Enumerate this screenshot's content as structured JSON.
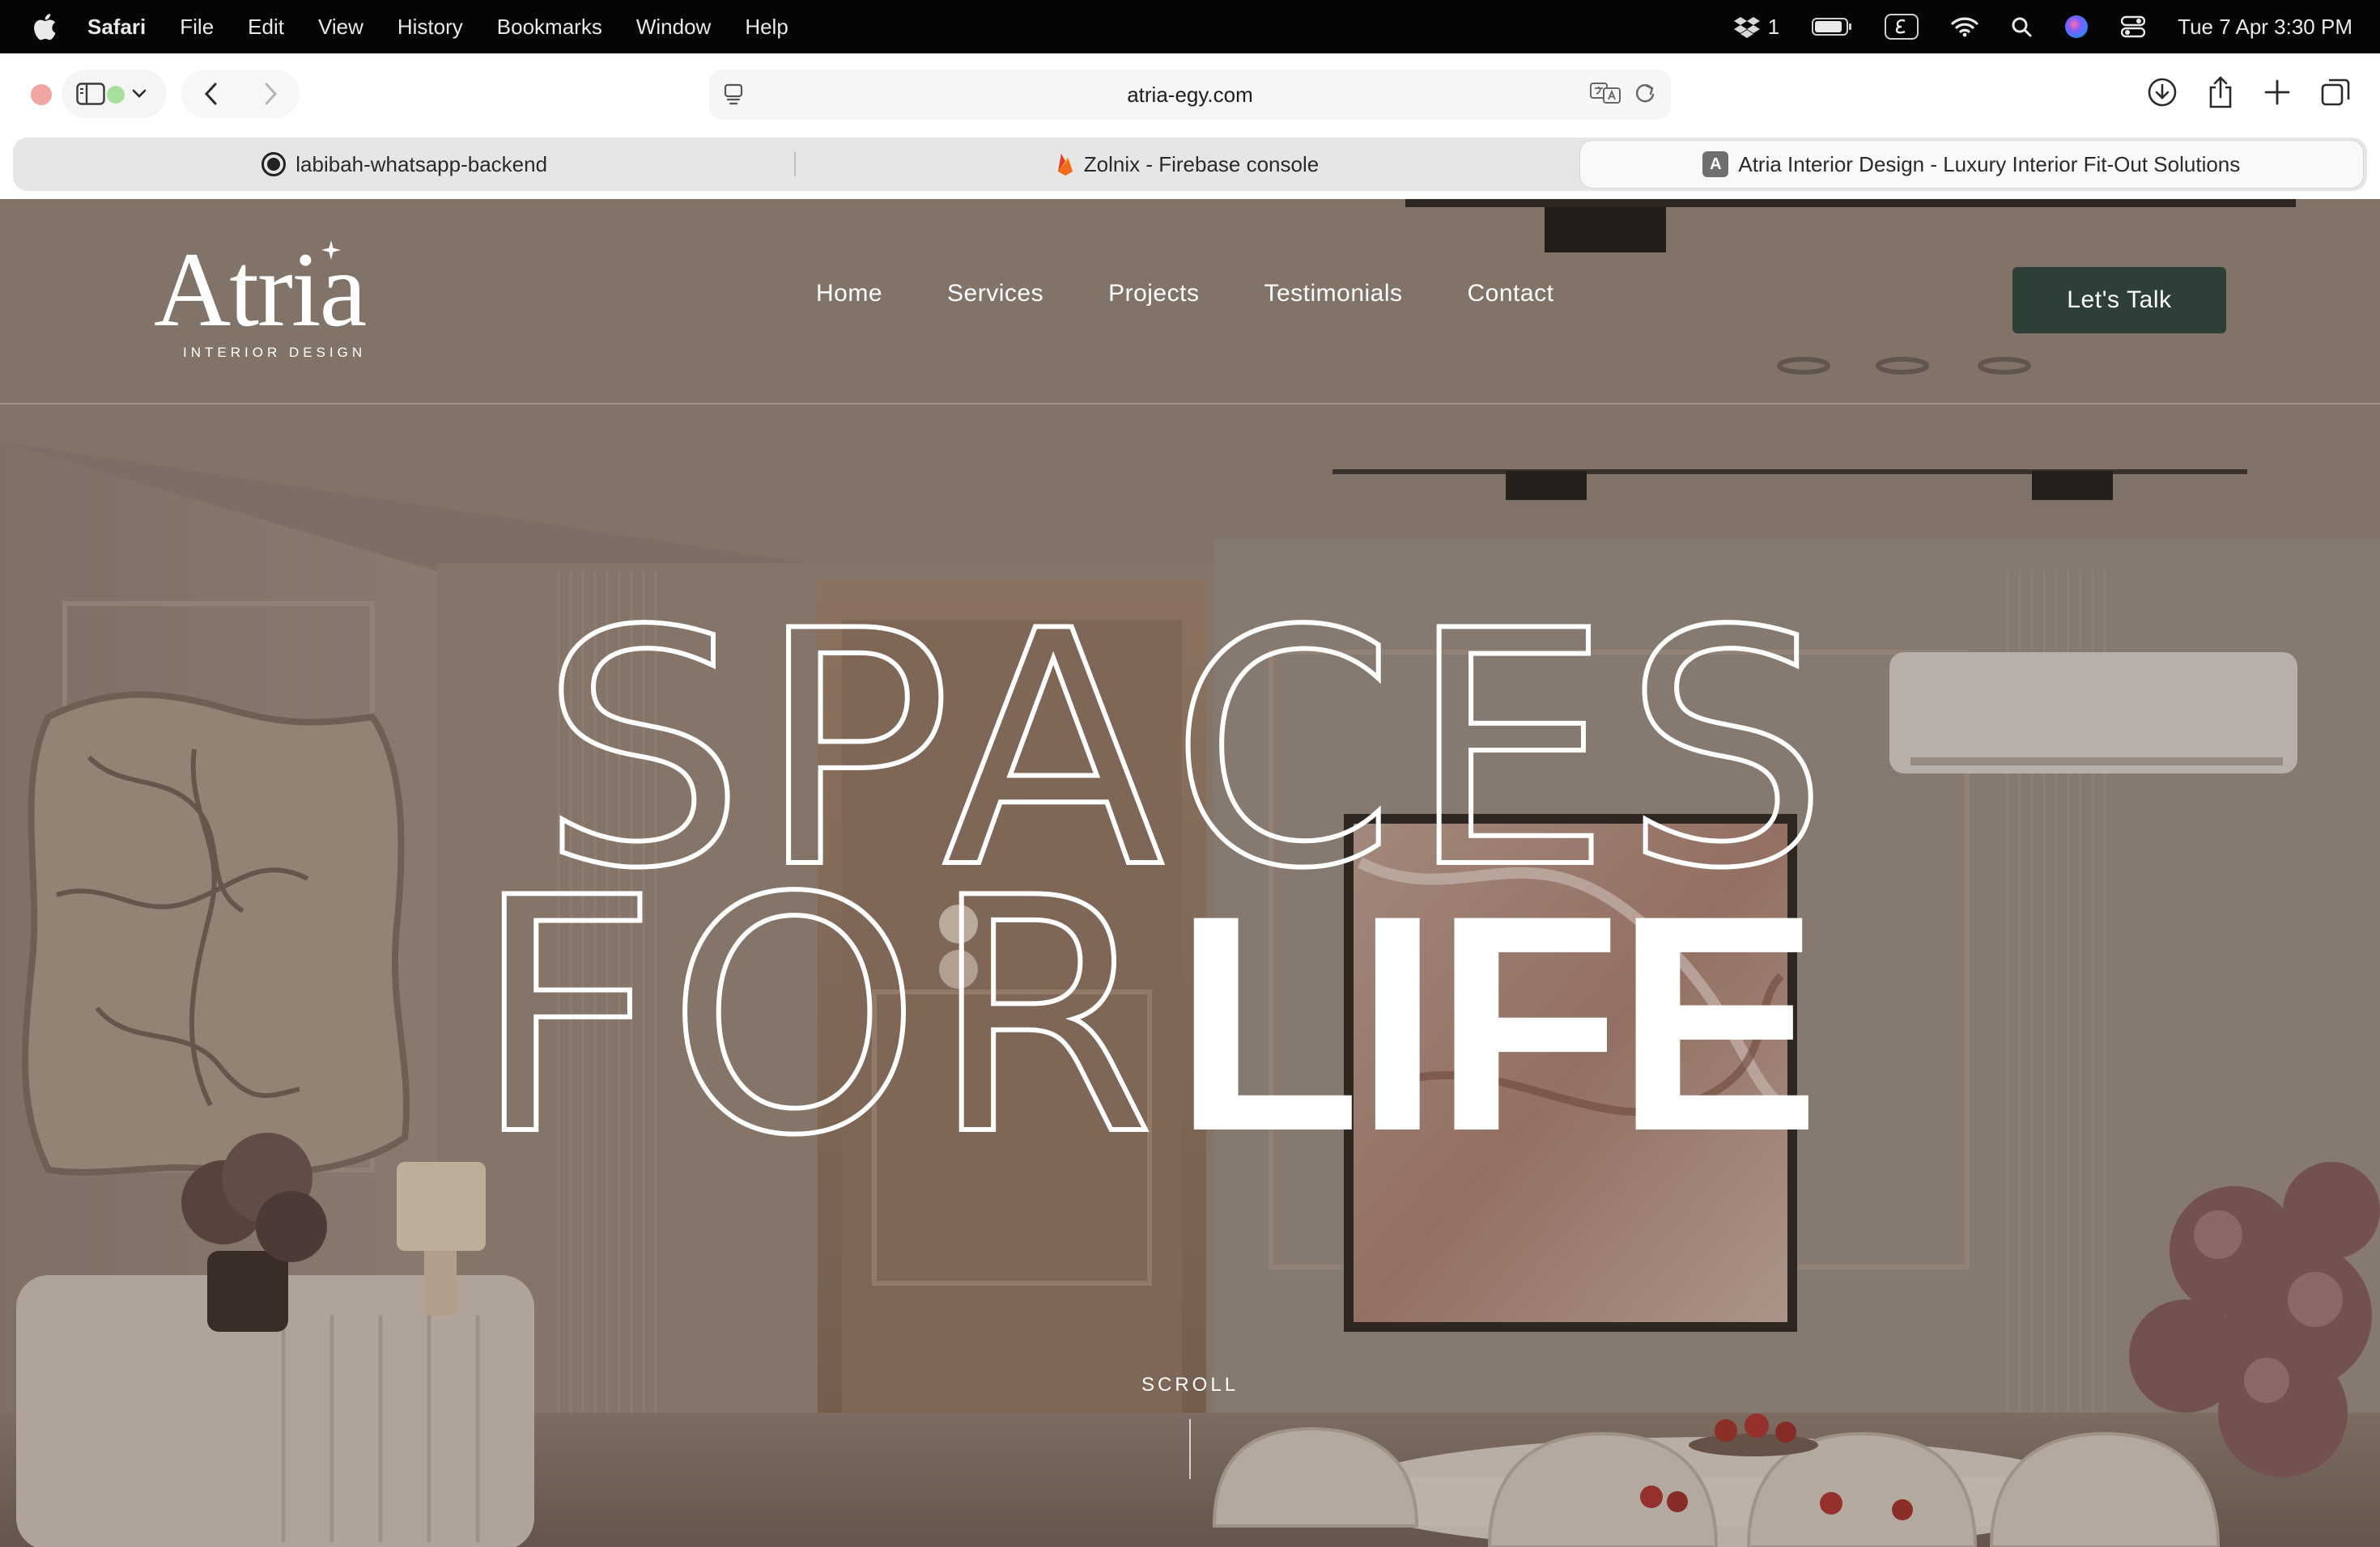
{
  "menubar": {
    "app_name": "Safari",
    "menus": [
      "File",
      "Edit",
      "View",
      "History",
      "Bookmarks",
      "Window",
      "Help"
    ],
    "extension_count": "1",
    "datetime": "Tue 7 Apr  3:30 PM",
    "icons": [
      "apple-icon",
      "dropbox-icon",
      "battery-icon",
      "input-source-icon",
      "wifi-icon",
      "spotlight-icon",
      "siri-icon",
      "control-center-icon"
    ]
  },
  "browser": {
    "url": "atria-egy.com",
    "tabs": [
      {
        "title": "labibah-whatsapp-backend",
        "icon": "github-icon",
        "active": false
      },
      {
        "title": "Zolnix - Firebase console",
        "icon": "firebase-icon",
        "active": false
      },
      {
        "title": "Atria Interior Design - Luxury Interior Fit-Out Solutions",
        "icon": "atria-favicon",
        "favicon_letter": "A",
        "active": true
      }
    ]
  },
  "site": {
    "logo": {
      "wordmark": "Atria",
      "tagline": "INTERIOR DESIGN"
    },
    "nav": [
      "Home",
      "Services",
      "Projects",
      "Testimonials",
      "Contact"
    ],
    "cta_label": "Let's Talk",
    "hero": {
      "line1": "SPACES",
      "line2_light": "FOR",
      "line2_bold": "LIFE"
    },
    "scroll_label": "SCROLL",
    "colors": {
      "cta_bg": "#2e3f38",
      "hero_text": "#ffffff"
    }
  }
}
